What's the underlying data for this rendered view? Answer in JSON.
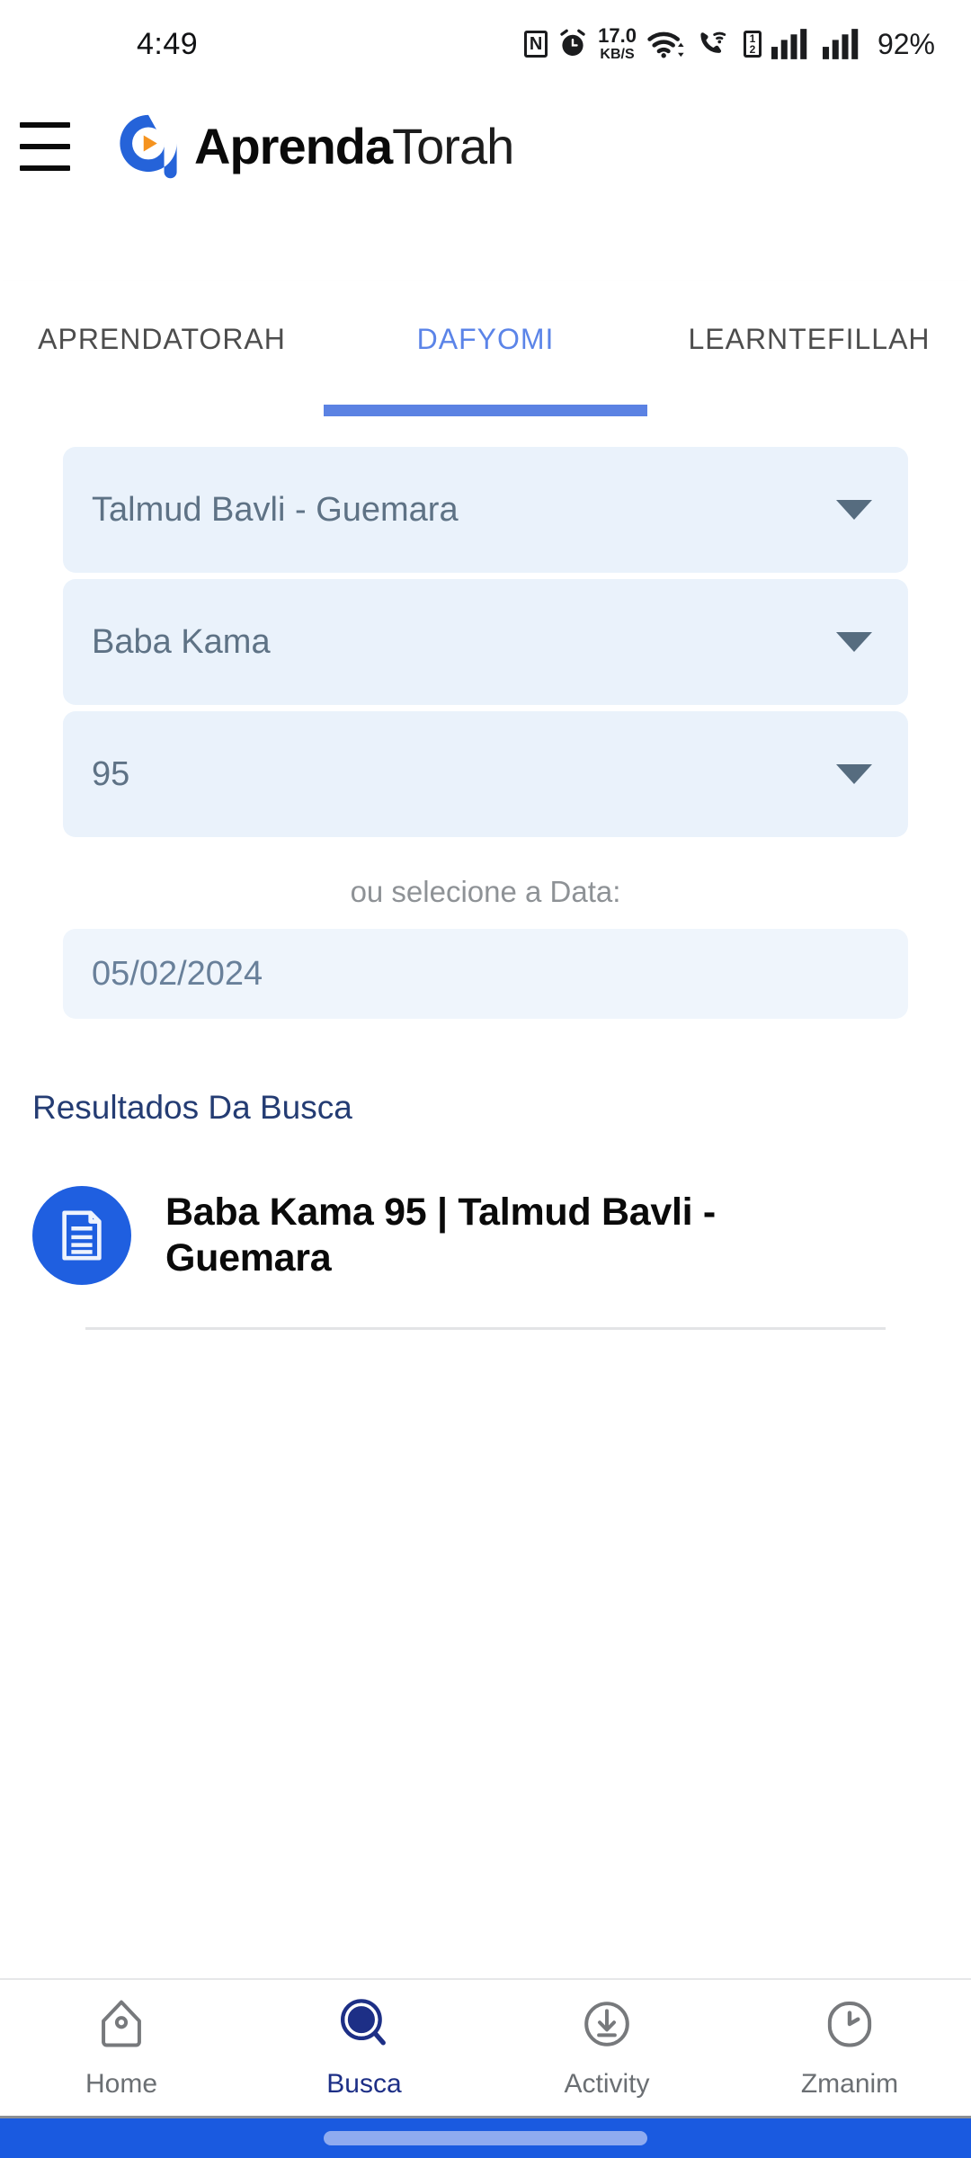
{
  "status_bar": {
    "time": "4:49",
    "net_speed_value": "17.0",
    "net_speed_unit": "KB/S",
    "nfc_glyph": "N",
    "sim_one": "1",
    "sim_two": "2",
    "battery": "92%",
    "icons": [
      "nfc-icon",
      "alarm-icon",
      "network-speed-indicator",
      "wifi-icon",
      "volte-call-icon",
      "dual-sim-icon",
      "signal-bars-icon-1",
      "signal-bars-icon-2"
    ]
  },
  "app_bar": {
    "menu_icon": "hamburger-menu-icon",
    "logo_icon": "aprendatorah-logo",
    "brand_bold": "Aprenda",
    "brand_light": "Torah"
  },
  "tabs": [
    {
      "label": "APRENDATORAH",
      "active": false
    },
    {
      "label": "DAFYOMI",
      "active": true
    },
    {
      "label": "LEARNTEFILLAH",
      "active": false
    }
  ],
  "form": {
    "selects": [
      {
        "name": "tractate-collection-select",
        "value": "Talmud Bavli - Guemara"
      },
      {
        "name": "tractate-select",
        "value": "Baba Kama"
      },
      {
        "name": "page-select",
        "value": "95"
      }
    ],
    "date_label": "ou selecione a Data:",
    "date_value": "05/02/2024"
  },
  "results": {
    "title": "Resultados Da Busca",
    "items": [
      {
        "icon": "document-icon",
        "title": "Baba Kama 95 | Talmud Bavli - Guemara"
      }
    ]
  },
  "bottom_nav": [
    {
      "label": "Home",
      "icon": "home-icon",
      "active": false
    },
    {
      "label": "Busca",
      "icon": "search-icon",
      "active": true
    },
    {
      "label": "Activity",
      "icon": "download-circle-icon",
      "active": false
    },
    {
      "label": "Zmanim",
      "icon": "clock-icon",
      "active": false
    }
  ],
  "colors": {
    "accent_blue": "#1f5fe0",
    "tab_active_blue": "#5b84e8",
    "field_bg": "#eaf2fb",
    "results_title": "#243c73",
    "nav_active": "#1d2f86",
    "gesture_bar": "#1a5ae0"
  }
}
